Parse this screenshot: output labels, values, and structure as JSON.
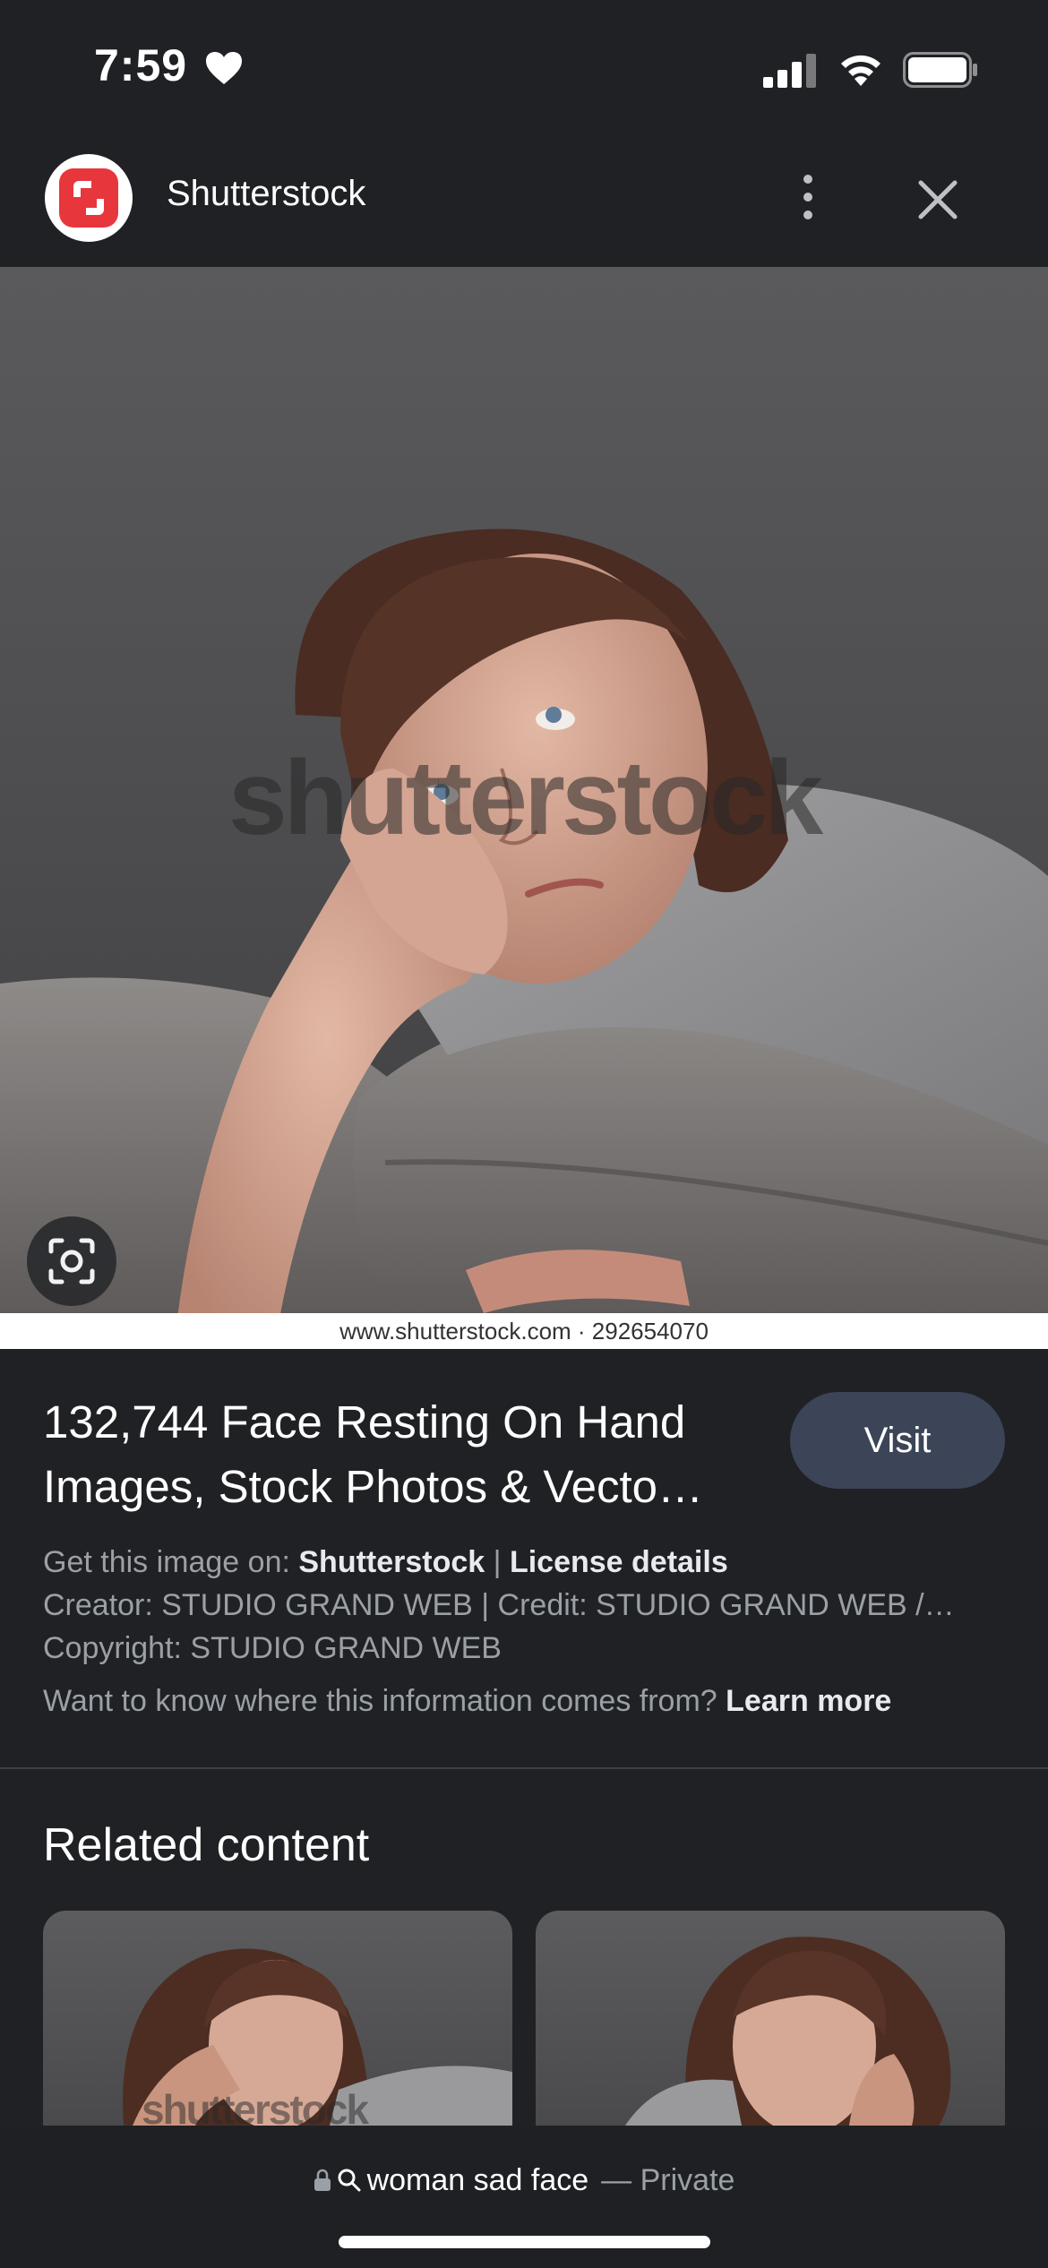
{
  "status_bar": {
    "time": "7:59"
  },
  "header": {
    "site_name": "Shutterstock",
    "logo_icon": "shutterstock-logo-icon",
    "brand_color": "#e8363d"
  },
  "image": {
    "watermark": "shutterstock",
    "source_caption": "www.shutterstock.com · 292654070"
  },
  "result": {
    "title": "132,744 Face Resting On Hand Images, Stock Photos & Vecto…",
    "visit_label": "Visit",
    "get_image_prefix": "Get this image on:",
    "get_image_source": "Shutterstock",
    "separator": "|",
    "license_label": "License details",
    "creator_line": "Creator: STUDIO GRAND WEB | Credit: STUDIO GRAND WEB /…",
    "copyright_line": "Copyright: STUDIO GRAND WEB",
    "info_question": "Want to know where this information comes from?",
    "learn_more_label": "Learn more"
  },
  "related": {
    "title": "Related content",
    "cards": [
      {
        "watermark": "shutterstock"
      },
      {
        "watermark": ""
      }
    ]
  },
  "bottom_bar": {
    "query": "woman sad face",
    "dash": "—",
    "private_label": "Private"
  }
}
